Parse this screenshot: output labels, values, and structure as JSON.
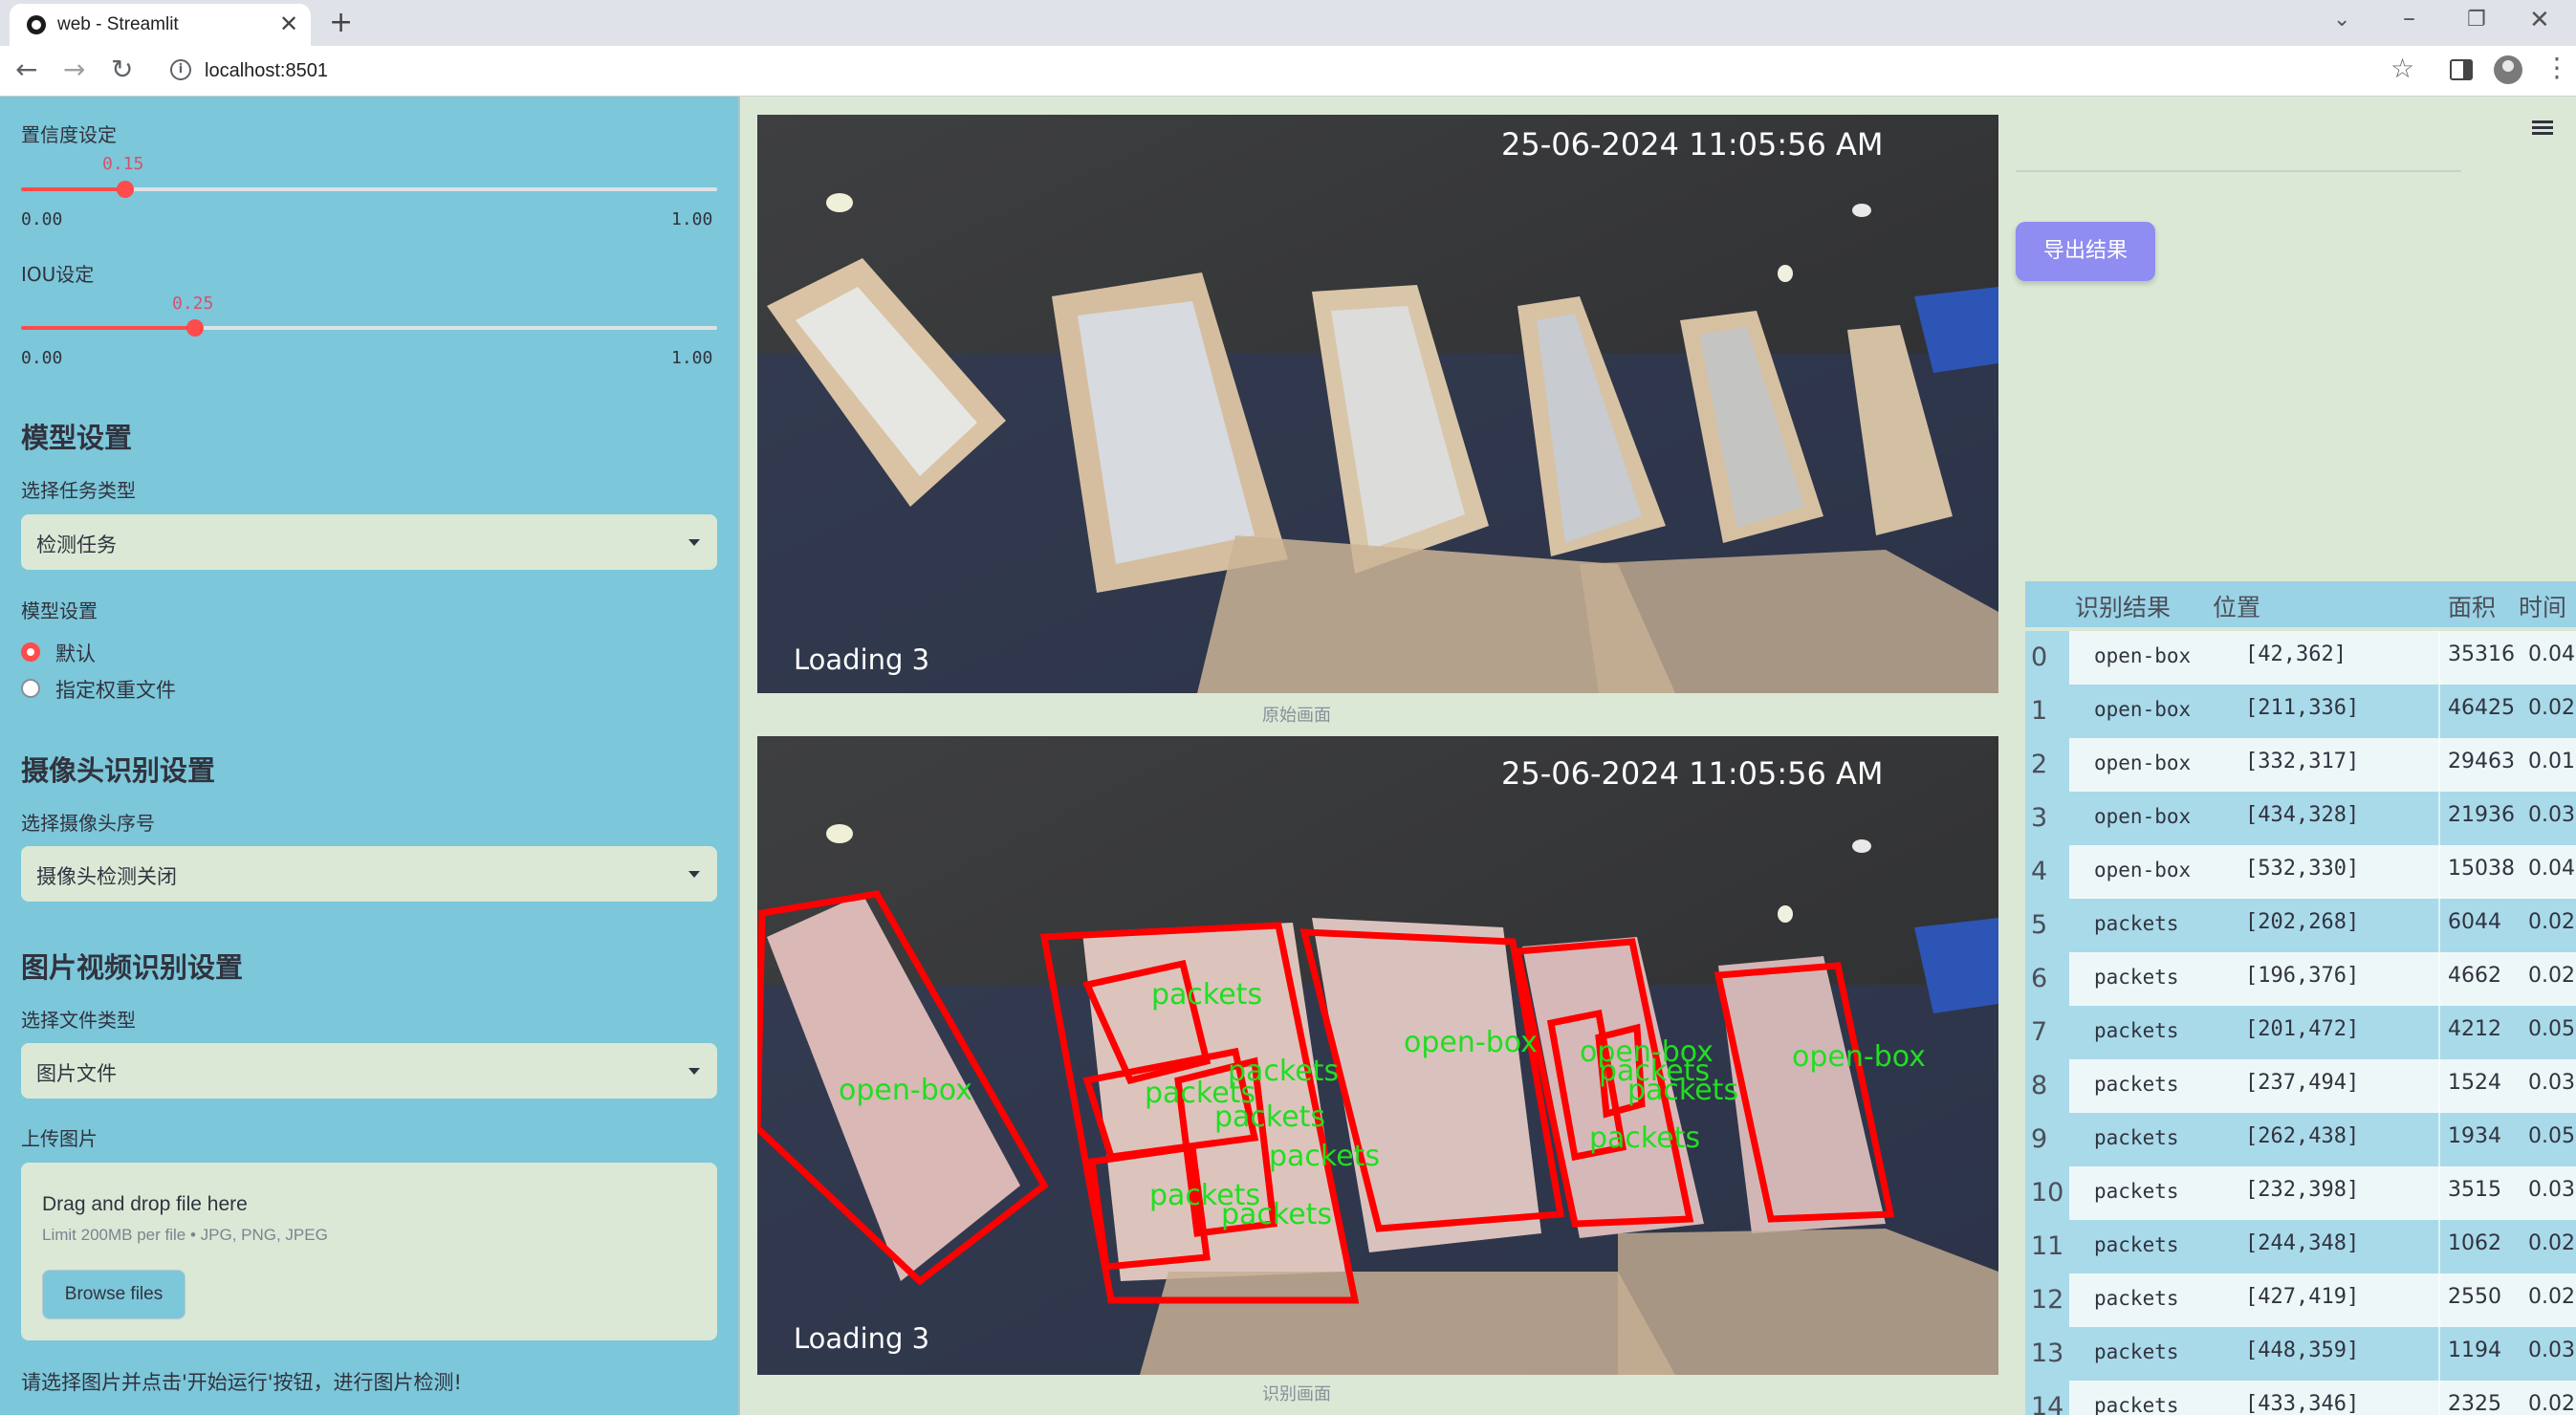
{
  "browser": {
    "tab_title": "web - Streamlit",
    "url": "localhost:8501"
  },
  "sidebar": {
    "confidence": {
      "label": "置信度设定",
      "value": "0.15",
      "min": "0.00",
      "max": "1.00",
      "fraction": 0.15
    },
    "iou": {
      "label": "IOU设定",
      "value": "0.25",
      "min": "0.00",
      "max": "1.00",
      "fraction": 0.25
    },
    "model_header": "模型设置",
    "task_label": "选择任务类型",
    "task_value": "检测任务",
    "weights_label": "模型设置",
    "weights_options": [
      "默认",
      "指定权重文件"
    ],
    "weights_selected": 0,
    "camera_header": "摄像头识别设置",
    "camera_label": "选择摄像头序号",
    "camera_value": "摄像头检测关闭",
    "media_header": "图片视频识别设置",
    "filetype_label": "选择文件类型",
    "filetype_value": "图片文件",
    "upload_label": "上传图片",
    "upload_title": "Drag and drop file here",
    "upload_limit": "Limit 200MB per file • JPG, PNG, JPEG",
    "browse_label": "Browse files",
    "footer_text": "请选择图片并点击'开始运行'按钮，进行图片检测!"
  },
  "main": {
    "original_caption": "原始画面",
    "detected_caption": "识别画面",
    "timestamp": "25-06-2024 11:05:56 AM",
    "camera_label": "Loading 3",
    "export_label": "导出结果",
    "detection_labels": [
      "open-box",
      "packets",
      "packets",
      "packets",
      "packets",
      "packets",
      "packets",
      "packets",
      "open-box",
      "open-box",
      "open-box",
      "packets",
      "packets",
      "packets"
    ]
  },
  "table": {
    "headers": [
      "识别结果",
      "位置",
      "面积",
      "时间"
    ],
    "rows": [
      {
        "idx": "0",
        "name": "open-box",
        "pos": "[42,362]",
        "area": "35316",
        "time": "0.04"
      },
      {
        "idx": "1",
        "name": "open-box",
        "pos": "[211,336]",
        "area": "46425",
        "time": "0.02"
      },
      {
        "idx": "2",
        "name": "open-box",
        "pos": "[332,317]",
        "area": "29463",
        "time": "0.01"
      },
      {
        "idx": "3",
        "name": "open-box",
        "pos": "[434,328]",
        "area": "21936",
        "time": "0.03"
      },
      {
        "idx": "4",
        "name": "open-box",
        "pos": "[532,330]",
        "area": "15038",
        "time": "0.04"
      },
      {
        "idx": "5",
        "name": "packets",
        "pos": "[202,268]",
        "area": "6044",
        "time": "0.02"
      },
      {
        "idx": "6",
        "name": "packets",
        "pos": "[196,376]",
        "area": "4662",
        "time": "0.02"
      },
      {
        "idx": "7",
        "name": "packets",
        "pos": "[201,472]",
        "area": "4212",
        "time": "0.05"
      },
      {
        "idx": "8",
        "name": "packets",
        "pos": "[237,494]",
        "area": "1524",
        "time": "0.03"
      },
      {
        "idx": "9",
        "name": "packets",
        "pos": "[262,438]",
        "area": "1934",
        "time": "0.05"
      },
      {
        "idx": "10",
        "name": "packets",
        "pos": "[232,398]",
        "area": "3515",
        "time": "0.03"
      },
      {
        "idx": "11",
        "name": "packets",
        "pos": "[244,348]",
        "area": "1062",
        "time": "0.02"
      },
      {
        "idx": "12",
        "name": "packets",
        "pos": "[427,419]",
        "area": "2550",
        "time": "0.02"
      },
      {
        "idx": "13",
        "name": "packets",
        "pos": "[448,359]",
        "area": "1194",
        "time": "0.03"
      },
      {
        "idx": "14",
        "name": "packets",
        "pos": "[433,346]",
        "area": "2325",
        "time": "0.02"
      }
    ]
  },
  "colors": {
    "sidebar_bg": "#7cc7d9",
    "main_bg": "#dbe8d6",
    "accent": "#ff4b4b",
    "export_button": "#8f8cf2",
    "box_stroke": "#ff0000",
    "box_label": "#22dd22"
  },
  "icons": [
    "streamlit-favicon",
    "close-icon",
    "plus-icon",
    "back-arrow-icon",
    "forward-arrow-icon",
    "reload-icon",
    "info-icon",
    "star-icon",
    "side-panel-icon",
    "profile-icon",
    "kebab-menu-icon",
    "hamburger-icon",
    "chevron-down-icon"
  ]
}
